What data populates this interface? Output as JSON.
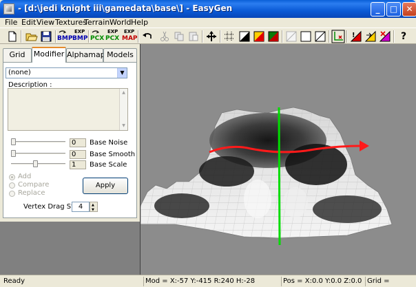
{
  "window": {
    "title": "- [d:\\jedi knight iii\\gamedata\\base\\] - EasyGen",
    "min_symbol": "_",
    "max_symbol": "□",
    "close_symbol": "✕"
  },
  "menu": [
    "File",
    "Edit",
    "View",
    "Textures",
    "Terrain",
    "World",
    "Help"
  ],
  "toolbar": {
    "bmp_import_top": "",
    "bmp_import_bottom": "BMP",
    "bmp_export_top": "EXP",
    "bmp_export_bottom": "BMP",
    "pcx_import_bottom": "PCX",
    "pcx_export_top": "EXP",
    "pcx_export_bottom": "PCX",
    "map_export_top": "EXP",
    "map_export_bottom": "MAP",
    "help_label": "?"
  },
  "tabs": [
    {
      "label": "Grid",
      "active": false
    },
    {
      "label": "Modifier",
      "active": true
    },
    {
      "label": "Alphamap",
      "active": false
    },
    {
      "label": "Models",
      "active": false
    }
  ],
  "modifier": {
    "selected_modifier": "(none)",
    "description_label": "Description :",
    "description_value": "",
    "sliders": [
      {
        "label": "Base Noise",
        "value": "0",
        "position": 0.0
      },
      {
        "label": "Base Smooth",
        "value": "0",
        "position": 0.0
      },
      {
        "label": "Base Scale",
        "value": "1",
        "position": 0.45
      }
    ],
    "radio_options": [
      {
        "label": "Add",
        "checked": true
      },
      {
        "label": "Compare",
        "checked": false
      },
      {
        "label": "Replace",
        "checked": false
      }
    ],
    "apply_label": "Apply",
    "vertex_drag_step_label": "Vertex Drag Step",
    "vertex_drag_step_value": "4"
  },
  "status": {
    "state": "Ready",
    "mod": "Mod = X:-57 Y:-415 R:240 H:-28",
    "pos": "Pos = X:0.0 Y:0.0 Z:0.0",
    "grid": "Grid ="
  },
  "colors": {
    "title_blue": "#0a5ad6",
    "viewport_bg": "#8c8c8c",
    "axis_green": "#00dd00",
    "axis_red": "#ff1a1a",
    "tab_active_accent": "#e68b2c"
  }
}
